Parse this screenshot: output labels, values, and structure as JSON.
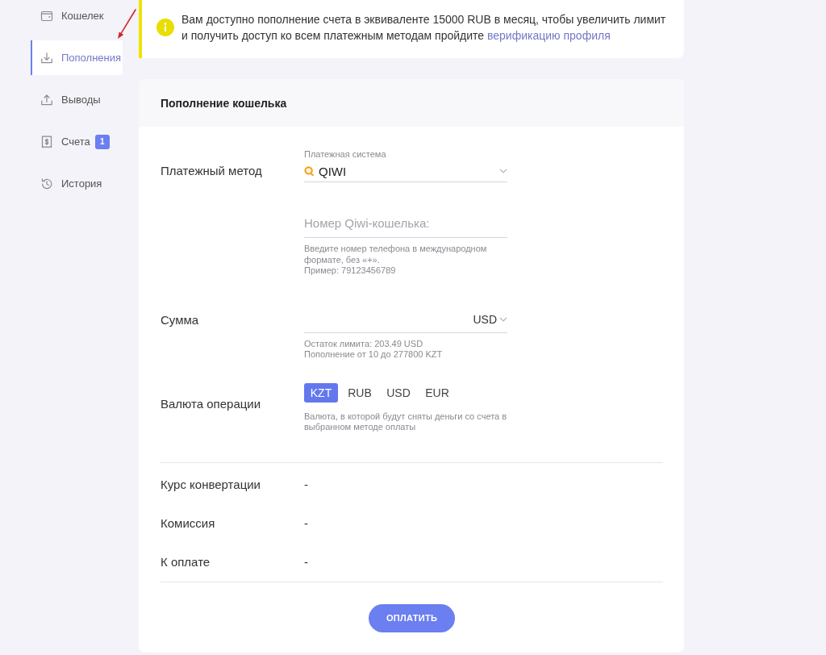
{
  "sidebar": {
    "items": [
      {
        "label": "Кошелек",
        "selected": false
      },
      {
        "label": "Пополнения",
        "selected": true
      },
      {
        "label": "Выводы",
        "selected": false
      },
      {
        "label": "Счета",
        "selected": false,
        "badge": "1"
      },
      {
        "label": "История",
        "selected": false
      }
    ]
  },
  "notice": {
    "text": "Вам доступно пополнение счета в эквиваленте 15000 RUB в месяц, чтобы увеличить лимит и получить доступ ко всем платежным методам пройдите",
    "link": "верификацию профиля"
  },
  "card": {
    "title": "Пополнение кошелька",
    "fields": [
      {
        "kind": "select",
        "label": "Платежный метод",
        "caption": "Платежная система",
        "value": "QIWI"
      },
      {
        "kind": "text_input",
        "placeholder": "Номер Qiwi-кошелька:",
        "hint": [
          "Введите номер телефона в международном формате, без «+».",
          "Пример: 79123456789"
        ]
      },
      {
        "kind": "amount",
        "label": "Сумма",
        "currency": "USD",
        "hint": [
          "Остаток лимита: 203.49 USD",
          "Пополнение от 10 до 277800 KZT"
        ]
      },
      {
        "kind": "choice",
        "label": "Валюта операции",
        "options": [
          {
            "label": "KZT",
            "selected": true
          },
          {
            "label": "RUB",
            "selected": false
          },
          {
            "label": "USD",
            "selected": false
          },
          {
            "label": "EUR",
            "selected": false
          }
        ],
        "hint": [
          "Валюта, в которой будут сняты деньги со счета в выбранном методе оплаты"
        ]
      }
    ],
    "summary": [
      {
        "label": "Курс конвертации",
        "value": "-"
      },
      {
        "label": "Комиссия",
        "value": "-"
      },
      {
        "label": "К оплате",
        "value": "-"
      }
    ],
    "button": "ОПЛАТИТЬ"
  }
}
